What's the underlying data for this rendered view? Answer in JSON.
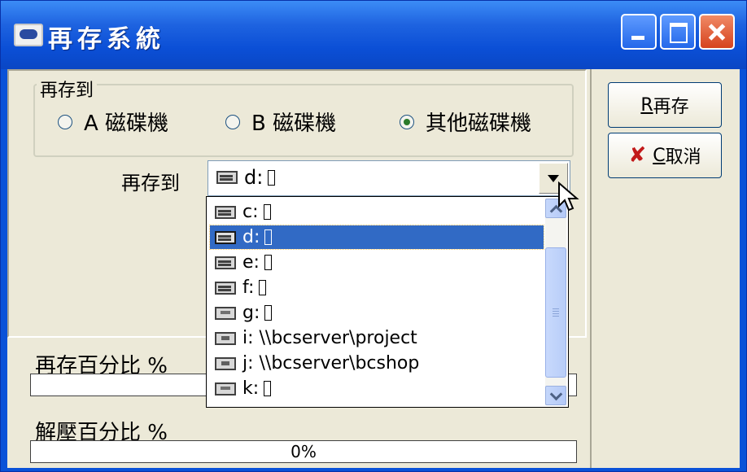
{
  "window": {
    "title": "再存系統"
  },
  "group": {
    "label": "再存到",
    "radios": [
      {
        "label": "A 磁碟機",
        "checked": false
      },
      {
        "label": "B 磁碟機",
        "checked": false
      },
      {
        "label": "其他磁碟機",
        "checked": true
      }
    ]
  },
  "save_to": {
    "label": "再存到",
    "selected": "d:",
    "options": [
      {
        "label": "c:",
        "icon": "drive-icon"
      },
      {
        "label": "d:",
        "icon": "drive-icon",
        "selected": true
      },
      {
        "label": "e:",
        "icon": "drive-icon"
      },
      {
        "label": "f:",
        "icon": "drive-icon"
      },
      {
        "label": "g:",
        "icon": "removable-drive-icon"
      },
      {
        "label": "i: \\\\bcserver\\project",
        "icon": "network-drive-icon"
      },
      {
        "label": "j: \\\\bcserver\\bcshop",
        "icon": "network-drive-icon"
      },
      {
        "label": "k:",
        "icon": "removable-drive-icon"
      }
    ]
  },
  "progress": {
    "save_label": "再存百分比 %",
    "save_value": "",
    "decompress_label": "解壓百分比 %",
    "decompress_value": "0%"
  },
  "buttons": {
    "save_accel": "R",
    "save_text": "再存",
    "cancel_accel": "C",
    "cancel_text": "取消",
    "cancel_icon": "✘"
  },
  "colors": {
    "title_blue": "#0b4fd6",
    "selection": "#316ac5",
    "face": "#ece9d8"
  }
}
